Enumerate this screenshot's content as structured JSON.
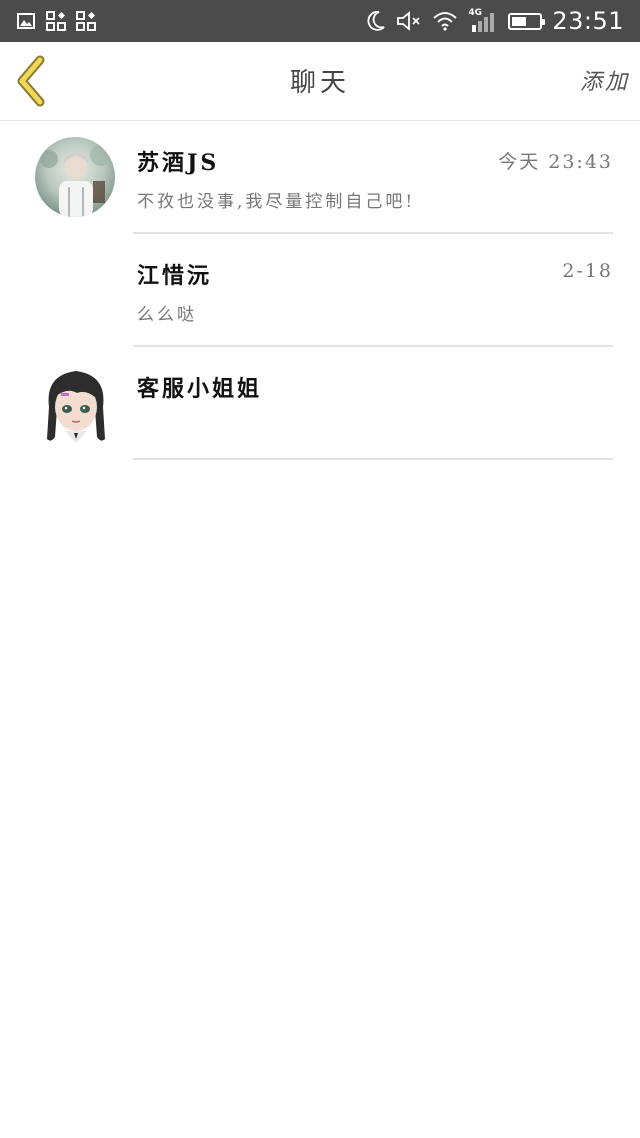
{
  "status_bar": {
    "time": "23:51",
    "network": "4G",
    "battery_level": 0.55,
    "icons": [
      "gallery-icon",
      "app-grid-icon",
      "app-grid-icon",
      "moon-icon",
      "mute-icon",
      "wifi-icon",
      "signal-icon",
      "battery-icon"
    ]
  },
  "header": {
    "title": "聊天",
    "action_label": "添加",
    "back_icon": "chevron-left-icon",
    "back_color": "#e0c84a"
  },
  "chats": [
    {
      "name": "苏酒JS",
      "time": "今天 23:43",
      "message": "不孜也没事,我尽量控制自己吧!",
      "avatar": "photo-avatar"
    },
    {
      "name": "江惜沅",
      "time": "2-18",
      "message": "么么哒",
      "avatar": ""
    },
    {
      "name": "客服小姐姐",
      "time": "",
      "message": "",
      "avatar": "anime-avatar"
    }
  ]
}
